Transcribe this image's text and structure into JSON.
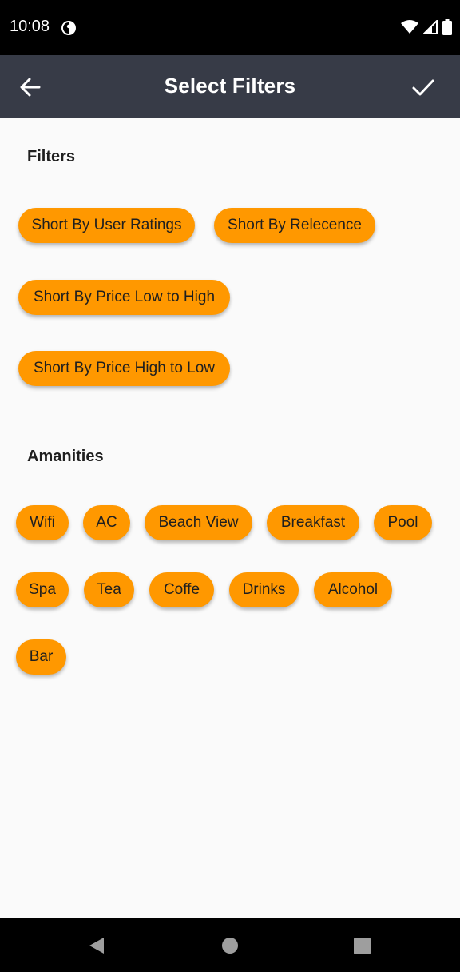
{
  "status_bar": {
    "time": "10:08"
  },
  "app_bar": {
    "title": "Select Filters"
  },
  "filters": {
    "title": "Filters",
    "chips": [
      "Short By User Ratings",
      "Short By Relecence",
      "Short By Price Low to High",
      "Short By Price High to Low"
    ]
  },
  "amenities": {
    "title": "Amanities",
    "chips": [
      "Wifi",
      "AC",
      "Beach View",
      "Breakfast",
      "Pool",
      "Spa",
      "Tea",
      "Coffe",
      "Drinks",
      "Alcohol",
      "Bar"
    ]
  },
  "colors": {
    "chip": "#ff9800",
    "app_bar": "#373b47",
    "background": "#fafafa"
  },
  "icons": {
    "back": "arrow-left-icon",
    "confirm": "check-icon",
    "nav_back": "triangle-back-icon",
    "nav_home": "circle-home-icon",
    "nav_recents": "square-recents-icon"
  }
}
